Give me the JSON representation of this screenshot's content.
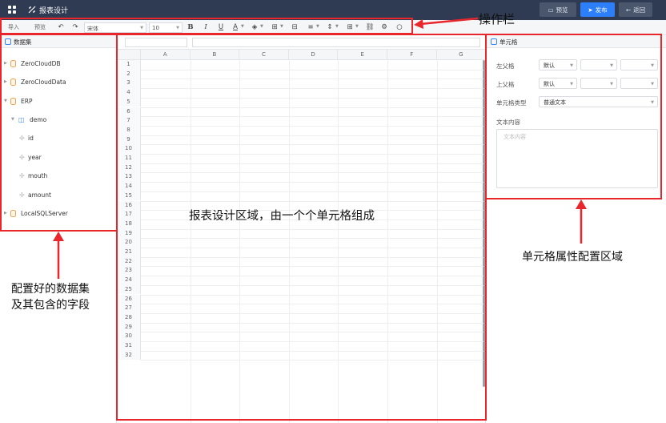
{
  "header": {
    "title": "报表设计",
    "preview_label": "预览",
    "publish_label": "发布",
    "back_label": "返回"
  },
  "toolbar": {
    "import_label": "导入",
    "preview_label": "预览",
    "font_family": "宋体",
    "font_size": "10"
  },
  "datasets": {
    "title": "数据集",
    "items": [
      {
        "label": "ZeroCloudDB",
        "type": "database"
      },
      {
        "label": "ZeroCloudData",
        "type": "database"
      },
      {
        "label": "ERP",
        "type": "database"
      },
      {
        "label": "demo",
        "type": "table"
      },
      {
        "label": "id",
        "type": "field"
      },
      {
        "label": "year",
        "type": "field"
      },
      {
        "label": "mouth",
        "type": "field"
      },
      {
        "label": "amount",
        "type": "field"
      },
      {
        "label": "LocalSQLServer",
        "type": "database"
      }
    ]
  },
  "grid": {
    "columns": [
      "A",
      "B",
      "C",
      "D",
      "E",
      "F",
      "G"
    ],
    "rows": [
      "1",
      "2",
      "3",
      "4",
      "5",
      "6",
      "7",
      "8",
      "9",
      "10",
      "11",
      "12",
      "13",
      "14",
      "15",
      "16",
      "17",
      "18",
      "19",
      "20",
      "21",
      "22",
      "23",
      "24",
      "25",
      "26",
      "27",
      "28",
      "29",
      "30",
      "31",
      "32"
    ]
  },
  "cell_panel": {
    "title": "单元格",
    "left_parent_label": "左父格",
    "left_parent_value": "默认",
    "top_parent_label": "上父格",
    "top_parent_value": "默认",
    "cell_type_label": "单元格类型",
    "cell_type_value": "普通文本",
    "content_label": "文本内容",
    "content_placeholder": "文本内容"
  },
  "annotations": {
    "toolbar": "操作栏",
    "grid": "报表设计区域，由一个个单元格组成",
    "datasets_line1": "配置好的数据集",
    "datasets_line2": "及其包含的字段",
    "cell_panel": "单元格属性配置区域"
  },
  "colors": {
    "header_bg": "#2f3b52",
    "publish_bg": "#2d7ff9",
    "annotation_red": "#e8262b"
  }
}
